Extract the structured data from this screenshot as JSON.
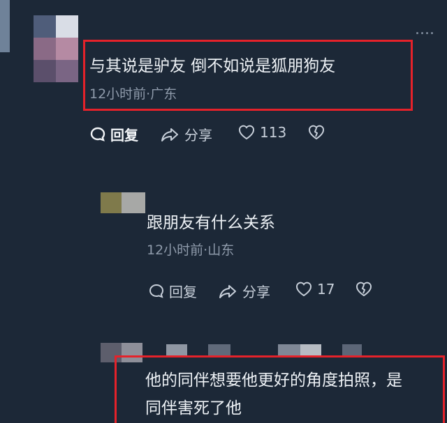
{
  "comments": [
    {
      "text": "与其说是驴友 倒不如说是狐朋狗友",
      "meta": "12小时前·广东",
      "reply_label": "回复",
      "share_label": "分享",
      "likes": "113"
    },
    {
      "text": "跟朋友有什么关系",
      "meta": "12小时前·山东",
      "reply_label": "回复",
      "share_label": "分享",
      "likes": "17"
    },
    {
      "text_line1": "他的同伴想要他更好的角度拍照，是",
      "text_line2": "同伴害死了他"
    }
  ],
  "icons": {
    "reply": "comment-bubble-icon",
    "share": "share-arrow-icon",
    "like": "heart-icon",
    "dislike": "broken-heart-icon",
    "more": "more-dots-icon"
  },
  "colors": {
    "background": "#1c2837",
    "highlight_border": "#e5222a"
  }
}
